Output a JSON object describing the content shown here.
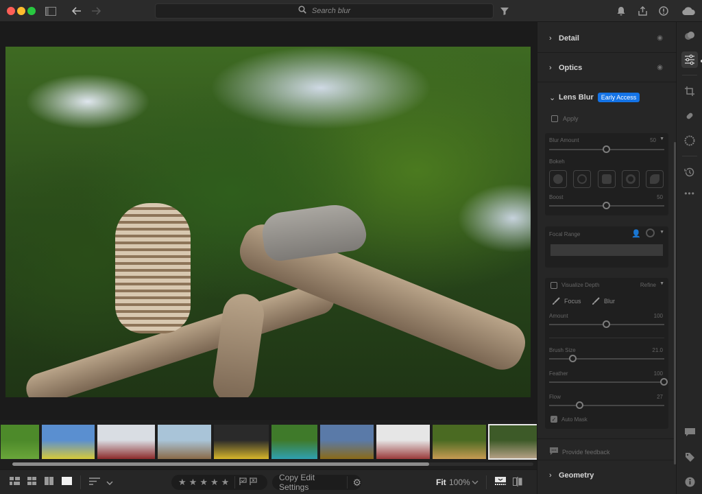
{
  "titlebar": {
    "search_placeholder": "Search blur",
    "icons": [
      "sidebar-toggle-icon",
      "back-arrow-icon",
      "forward-arrow-icon",
      "search-icon",
      "filter-icon",
      "bell-icon",
      "share-icon",
      "help-icon",
      "cloud-icon"
    ]
  },
  "filmstrip": {
    "thumbnails": [
      {
        "label": "dog-on-grass",
        "colors": [
          "#4d8a2a",
          "#6aa63a"
        ]
      },
      {
        "label": "child-in-dandelions",
        "colors": [
          "#5a8fd0",
          "#d6c93a"
        ]
      },
      {
        "label": "red-barn-snow",
        "colors": [
          "#d9dde3",
          "#8c2a2a"
        ]
      },
      {
        "label": "desert-wreck",
        "colors": [
          "#a9c4d8",
          "#8a6a48"
        ]
      },
      {
        "label": "yellow-machinery",
        "colors": [
          "#2a2a2a",
          "#d7b62a"
        ]
      },
      {
        "label": "horse-rider",
        "colors": [
          "#3f7a2a",
          "#2fa0b0"
        ]
      },
      {
        "label": "sunflower-field",
        "colors": [
          "#5a7aa8",
          "#8a6a18"
        ]
      },
      {
        "label": "snowy-christmas-tree",
        "colors": [
          "#e6e6e6",
          "#9a3a3a"
        ]
      },
      {
        "label": "golden-retriever",
        "colors": [
          "#4a6a22",
          "#c69a52"
        ]
      },
      {
        "label": "owl-and-squirrel",
        "colors": [
          "#3d5a28",
          "#b4a085"
        ],
        "selected": true
      }
    ],
    "scroll_fraction": 0.8
  },
  "bottombar": {
    "view_icons": [
      "grid-view-icon",
      "square-grid-icon",
      "compare-view-icon",
      "single-view-icon"
    ],
    "sort_icon": "sort-icon",
    "rating_stars": 5,
    "rating_value": 0,
    "flag_icons": [
      "flag-pick-icon",
      "flag-reject-icon"
    ],
    "copy_edit_label": "Copy Edit Settings",
    "fit_label": "Fit",
    "zoom_label": "100%"
  },
  "panel": {
    "sections": {
      "detail": "Detail",
      "optics": "Optics",
      "lens_blur": "Lens Blur",
      "geometry": "Geometry"
    },
    "early_access_badge": "Early Access",
    "apply_label": "Apply",
    "apply_checked": false,
    "blur_amount": {
      "label": "Blur Amount",
      "value": "50",
      "fraction": 0.5
    },
    "bokeh": {
      "label": "Bokeh",
      "options": [
        "circle",
        "bubble",
        "blade",
        "ring",
        "cat-eye"
      ]
    },
    "boost": {
      "label": "Boost",
      "value": "50",
      "fraction": 0.5
    },
    "focal_range": {
      "label": "Focal Range"
    },
    "visualize_depth": {
      "label": "Visualize Depth",
      "checked": false
    },
    "refine_label": "Refine",
    "focus_label": "Focus",
    "blur_label": "Blur",
    "amount": {
      "label": "Amount",
      "value": "100",
      "fraction": 0.5
    },
    "brush_size": {
      "label": "Brush Size",
      "value": "21.0",
      "fraction": 0.21
    },
    "feather": {
      "label": "Feather",
      "value": "100",
      "fraction": 1.0
    },
    "flow": {
      "label": "Flow",
      "value": "27",
      "fraction": 0.27
    },
    "auto_mask": {
      "label": "Auto Mask",
      "checked": true
    },
    "feedback_label": "Provide feedback"
  },
  "rail": {
    "icons": [
      "presets-icon",
      "edit-sliders-icon",
      "crop-icon",
      "healing-icon",
      "masking-icon",
      "history-icon",
      "more-icon",
      "comments-icon",
      "keywords-icon",
      "info-icon"
    ],
    "active": "edit-sliders-icon"
  }
}
